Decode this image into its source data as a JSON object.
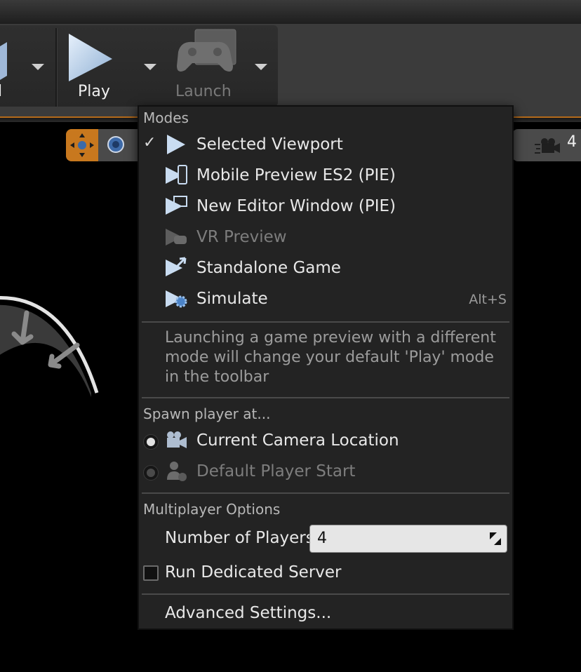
{
  "toolbar": {
    "left_partial_label": "l",
    "play_label": "Play",
    "launch_label": "Launch"
  },
  "viewport_toolbar": {
    "camera_speed": "4"
  },
  "icons": {
    "play": "play-icon",
    "launch": "gamepad-icon",
    "translate": "move-gizmo-icon",
    "rotate": "rotate-gizmo-icon",
    "camera_speed": "camera-speed-icon"
  },
  "menu": {
    "modes_title": "Modes",
    "modes": [
      {
        "label": "Selected Viewport",
        "checked": true,
        "enabled": true,
        "icon": "play-viewport-icon",
        "shortcut": ""
      },
      {
        "label": "Mobile Preview ES2 (PIE)",
        "checked": false,
        "enabled": true,
        "icon": "mobile-preview-icon",
        "shortcut": ""
      },
      {
        "label": "New Editor Window (PIE)",
        "checked": false,
        "enabled": true,
        "icon": "new-window-icon",
        "shortcut": ""
      },
      {
        "label": "VR Preview",
        "checked": false,
        "enabled": false,
        "icon": "vr-preview-icon",
        "shortcut": ""
      },
      {
        "label": "Standalone Game",
        "checked": false,
        "enabled": true,
        "icon": "standalone-game-icon",
        "shortcut": ""
      },
      {
        "label": "Simulate",
        "checked": false,
        "enabled": true,
        "icon": "simulate-icon",
        "shortcut": "Alt+S"
      }
    ],
    "modes_description": "Launching a game preview with a different mode will change your default 'Play' mode in the toolbar",
    "spawn_title": "Spawn player at...",
    "spawn_options": [
      {
        "label": "Current Camera Location",
        "selected": true,
        "enabled": true,
        "icon": "camera-icon"
      },
      {
        "label": "Default Player Start",
        "selected": false,
        "enabled": false,
        "icon": "player-start-icon"
      }
    ],
    "multiplayer_title": "Multiplayer Options",
    "number_of_players_label": "Number of Players",
    "number_of_players_value": "4",
    "dedicated_server_label": "Run Dedicated Server",
    "dedicated_server_checked": false,
    "advanced_settings_label": "Advanced Settings..."
  },
  "colors": {
    "accent_orange": "#c8781e",
    "menu_bg": "#232323",
    "play_icon": "#b8d4f0"
  }
}
